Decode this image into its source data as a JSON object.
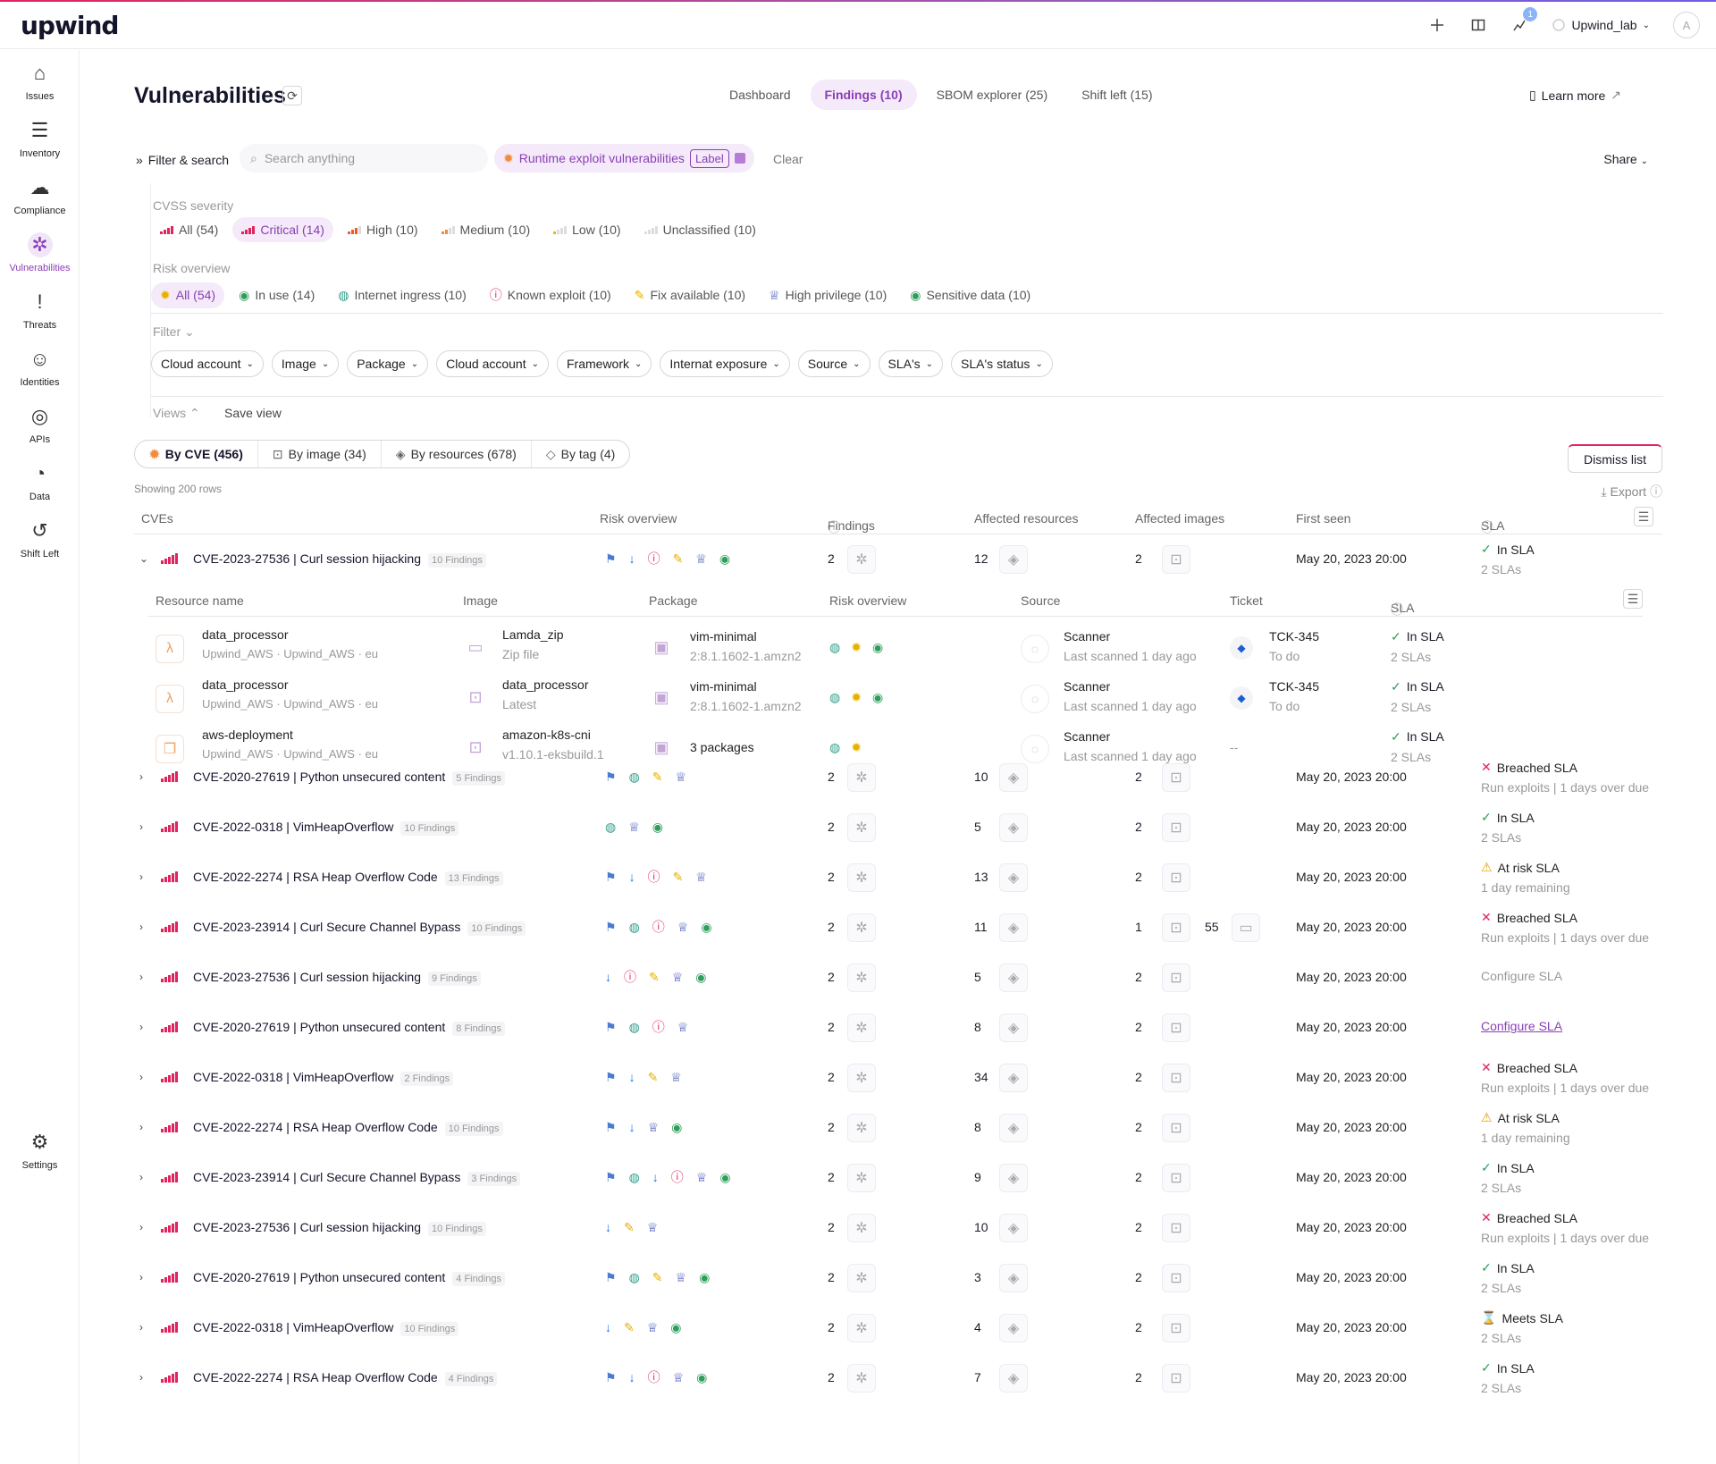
{
  "app": {
    "logo": "upwind",
    "account": "Upwind_lab",
    "avatar": "A",
    "notifications": "1"
  },
  "sidebar": [
    {
      "label": "Issues",
      "icon": "home-icon"
    },
    {
      "label": "Inventory",
      "icon": "list-icon"
    },
    {
      "label": "Compliance",
      "icon": "cloud-icon"
    },
    {
      "label": "Vulnerabilities",
      "icon": "bug-icon",
      "active": true
    },
    {
      "label": "Threats",
      "icon": "exclamation-icon"
    },
    {
      "label": "Identities",
      "icon": "person-icon"
    },
    {
      "label": "APIs",
      "icon": "globe-icon"
    },
    {
      "label": "Data",
      "icon": "pie-icon"
    },
    {
      "label": "Shift Left",
      "icon": "undo-icon"
    },
    {
      "label": "Settings",
      "icon": "sliders-icon"
    }
  ],
  "page": {
    "title": "Vulnerabilities",
    "learn_more": "Learn more",
    "tabs": [
      {
        "label": "Dashboard"
      },
      {
        "label": "Findings (10)",
        "active": true
      },
      {
        "label": "SBOM explorer (25)"
      },
      {
        "label": "Shift left (15)"
      }
    ]
  },
  "filters": {
    "filter_search": "Filter & search",
    "search_placeholder": "Search anything",
    "chip": "Runtime exploit vulnerabilities",
    "chip_label": "Label",
    "clear": "Clear",
    "share": "Share",
    "cvss_title": "CVSS severity",
    "cvss": [
      "All (54)",
      "Critical (14)",
      "High (10)",
      "Medium (10)",
      "Low (10)",
      "Unclassified (10)"
    ],
    "risk_title": "Risk overview",
    "risk": [
      "All (54)",
      "In use (14)",
      "Internet ingress (10)",
      "Known exploit (10)",
      "Fix available (10)",
      "High privilege (10)",
      "Sensitive data (10)"
    ],
    "filter_title": "Filter",
    "dropdowns": [
      "Cloud account",
      "Image",
      "Package",
      "Cloud account",
      "Framework",
      "Internat exposure",
      "Source",
      "SLA's",
      "SLA's status"
    ],
    "views": "Views",
    "save_view": "Save view"
  },
  "grouping": [
    "By CVE (456)",
    "By image (34)",
    "By resources (678)",
    "By tag (4)"
  ],
  "dismiss": "Dismiss list",
  "showing": "Showing 200 rows",
  "export": "Export",
  "columns": {
    "cves": "CVEs",
    "risk": "Risk overview",
    "findings": "Findings",
    "resources": "Affected resources",
    "images": "Affected images",
    "first_seen": "First seen",
    "sla": "SLA"
  },
  "subcolumns": {
    "resource": "Resource name",
    "image": "Image",
    "package": "Package",
    "risk": "Risk overview",
    "source": "Source",
    "ticket": "Ticket",
    "sla": "SLA"
  },
  "rows": [
    {
      "name": "CVE-2023-27536 | Curl session hijacking",
      "findings": "10 Findings",
      "risk": [
        "run",
        "down",
        "exploit",
        "fix",
        "crown",
        "data"
      ],
      "f": "2",
      "res": "12",
      "img": "2",
      "date": "May 20, 2023 20:00",
      "sla": "In SLA",
      "sla2": "2 SLAs",
      "status": "ok",
      "expanded": true
    },
    {
      "name": "CVE-2020-27619 | Python unsecured content",
      "findings": "5 Findings",
      "risk": [
        "run",
        "globe",
        "fix",
        "crown"
      ],
      "f": "2",
      "res": "10",
      "img": "2",
      "date": "May 20, 2023 20:00",
      "sla": "Breached SLA",
      "sla2": "Run exploits | 1 days over due",
      "status": "bad"
    },
    {
      "name": "CVE-2022-0318 | VimHeapOverflow",
      "findings": "10 Findings",
      "risk": [
        "globe",
        "crown",
        "data"
      ],
      "f": "2",
      "res": "5",
      "img": "2",
      "date": "May 20, 2023 20:00",
      "sla": "In SLA",
      "sla2": "2 SLAs",
      "status": "ok"
    },
    {
      "name": "CVE-2022-2274 | RSA Heap Overflow Code",
      "findings": "13 Findings",
      "risk": [
        "run",
        "down",
        "exploit",
        "fix",
        "crown"
      ],
      "f": "2",
      "res": "13",
      "img": "2",
      "date": "May 20, 2023 20:00",
      "sla": "At risk SLA",
      "sla2": "1 day remaining",
      "status": "warn"
    },
    {
      "name": "CVE-2023-23914 | Curl Secure Channel Bypass",
      "findings": "10 Findings",
      "risk": [
        "run",
        "globe",
        "exploit",
        "crown",
        "data"
      ],
      "f": "2",
      "res": "11",
      "img": "1",
      "extra": "55",
      "date": "May 20, 2023 20:00",
      "sla": "Breached SLA",
      "sla2": "Run exploits | 1 days over due",
      "status": "bad"
    },
    {
      "name": "CVE-2023-27536 | Curl session hijacking",
      "findings": "9 Findings",
      "risk": [
        "down",
        "exploit",
        "fix",
        "crown",
        "data"
      ],
      "f": "2",
      "res": "5",
      "img": "2",
      "date": "May 20, 2023 20:00",
      "sla": "Configure SLA",
      "sla2": "",
      "status": "cfg"
    },
    {
      "name": "CVE-2020-27619 | Python unsecured content",
      "findings": "8 Findings",
      "risk": [
        "run",
        "globe",
        "exploit",
        "crown"
      ],
      "f": "2",
      "res": "8",
      "img": "2",
      "date": "May 20, 2023 20:00",
      "sla": "Configure SLA",
      "sla2": "",
      "status": "link"
    },
    {
      "name": "CVE-2022-0318 | VimHeapOverflow",
      "findings": "2 Findings",
      "risk": [
        "run",
        "down",
        "fix",
        "crown"
      ],
      "f": "2",
      "res": "34",
      "img": "2",
      "date": "May 20, 2023 20:00",
      "sla": "Breached SLA",
      "sla2": "Run exploits | 1 days over due",
      "status": "bad"
    },
    {
      "name": "CVE-2022-2274 | RSA Heap Overflow Code",
      "findings": "10 Findings",
      "risk": [
        "run",
        "down",
        "crown",
        "data"
      ],
      "f": "2",
      "res": "8",
      "img": "2",
      "date": "May 20, 2023 20:00",
      "sla": "At risk SLA",
      "sla2": "1 day remaining",
      "status": "warn"
    },
    {
      "name": "CVE-2023-23914 | Curl Secure Channel Bypass",
      "findings": "3 Findings",
      "risk": [
        "run",
        "globe",
        "down",
        "exploit",
        "crown",
        "data"
      ],
      "f": "2",
      "res": "9",
      "img": "2",
      "date": "May 20, 2023 20:00",
      "sla": "In SLA",
      "sla2": "2 SLAs",
      "status": "ok"
    },
    {
      "name": "CVE-2023-27536 | Curl session hijacking",
      "findings": "10 Findings",
      "risk": [
        "down",
        "fix",
        "crown"
      ],
      "f": "2",
      "res": "10",
      "img": "2",
      "date": "May 20, 2023 20:00",
      "sla": "Breached SLA",
      "sla2": "Run exploits | 1 days over due",
      "status": "bad"
    },
    {
      "name": "CVE-2020-27619 | Python unsecured content",
      "findings": "4 Findings",
      "risk": [
        "run",
        "globe",
        "fix",
        "crown",
        "data"
      ],
      "f": "2",
      "res": "3",
      "img": "2",
      "date": "May 20, 2023 20:00",
      "sla": "In SLA",
      "sla2": "2 SLAs",
      "status": "ok"
    },
    {
      "name": "CVE-2022-0318 | VimHeapOverflow",
      "findings": "10 Findings",
      "risk": [
        "down",
        "fix",
        "crown",
        "data"
      ],
      "f": "2",
      "res": "4",
      "img": "2",
      "date": "May 20, 2023 20:00",
      "sla": "Meets SLA",
      "sla2": "2 SLAs",
      "status": "meets"
    },
    {
      "name": "CVE-2022-2274 | RSA Heap Overflow Code",
      "findings": "4 Findings",
      "risk": [
        "run",
        "down",
        "exploit",
        "crown",
        "data"
      ],
      "f": "2",
      "res": "7",
      "img": "2",
      "date": "May 20, 2023 20:00",
      "sla": "In SLA",
      "sla2": "2 SLAs",
      "status": "ok"
    }
  ],
  "subrows": [
    {
      "name": "data_processor",
      "meta": "Upwind_AWS · Upwind_AWS · eu",
      "icon": "lambda-icon",
      "img": "Lamda_zip",
      "img2": "Zip file",
      "pkg": "vim-minimal",
      "pkg2": "2:8.1.1602-1.amzn2",
      "risk": [
        "globe",
        "star",
        "data"
      ],
      "src": "Scanner",
      "src2": "Last scanned 1 day ago",
      "tk": "TCK-345",
      "tk2": "To do",
      "sla": "In SLA",
      "sla2": "2 SLAs"
    },
    {
      "name": "data_processor",
      "meta": "Upwind_AWS · Upwind_AWS · eu",
      "icon": "lambda-icon",
      "img": "data_processor",
      "img2": "Latest",
      "pkg": "vim-minimal",
      "pkg2": "2:8.1.1602-1.amzn2",
      "risk": [
        "globe",
        "star",
        "data"
      ],
      "src": "Scanner",
      "src2": "Last scanned 1 day ago",
      "tk": "TCK-345",
      "tk2": "To do",
      "sla": "In SLA",
      "sla2": "2 SLAs"
    },
    {
      "name": "aws-deployment",
      "meta": "Upwind_AWS · Upwind_AWS · eu",
      "icon": "deployment-icon",
      "img": "amazon-k8s-cni",
      "img2": "v1.10.1-eksbuild.1",
      "pkg": "3 packages",
      "pkg2": "",
      "risk": [
        "globe",
        "star"
      ],
      "src": "Scanner",
      "src2": "Last scanned 1 day ago",
      "tk": "",
      "tk2": "",
      "tkdash": "--",
      "sla": "In SLA",
      "sla2": "2 SLAs"
    }
  ],
  "colors": {
    "accent": "#8a3fb5",
    "critical": "#e0245e",
    "ok": "#2e9e5a",
    "warn": "#e69b00"
  }
}
